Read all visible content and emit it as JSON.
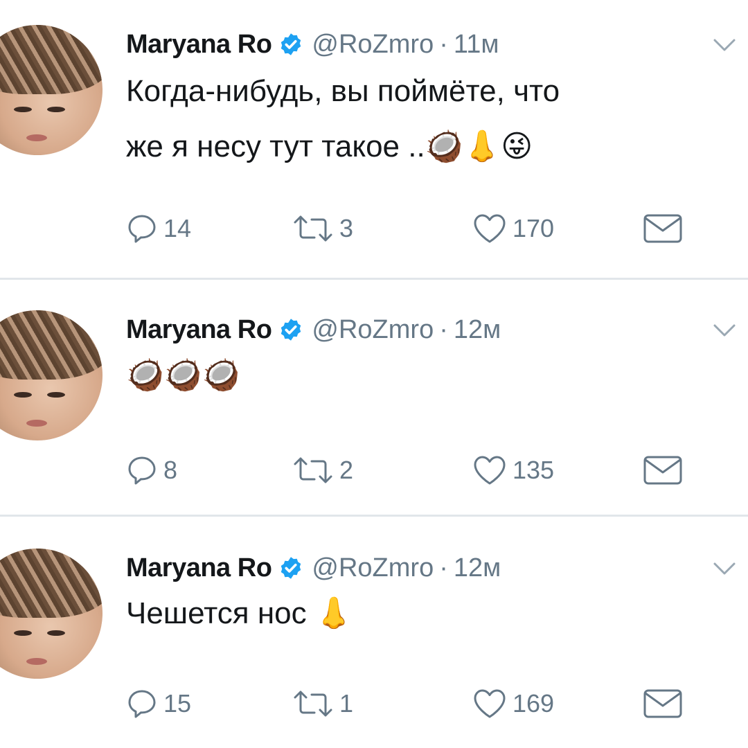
{
  "tweets": [
    {
      "name": "Maryana Ro",
      "handle": "@RoZmro",
      "separator": "·",
      "time": "11м",
      "text": "Когда-нибудь, вы поймёте, что\nже я несу тут такое ..🥥👃😜",
      "replies": "14",
      "retweets": "3",
      "likes": "170"
    },
    {
      "name": "Maryana Ro",
      "handle": "@RoZmro",
      "separator": "·",
      "time": "12м",
      "text": "🥥🥥🥥",
      "replies": "8",
      "retweets": "2",
      "likes": "135"
    },
    {
      "name": "Maryana Ro",
      "handle": "@RoZmro",
      "separator": "·",
      "time": "12м",
      "text": "Чешется нос 👃",
      "replies": "15",
      "retweets": "1",
      "likes": "169"
    }
  ],
  "icons": {
    "verified": "verified-badge-icon",
    "chevron": "chevron-down-icon",
    "reply": "reply-icon",
    "retweet": "retweet-icon",
    "like": "heart-icon",
    "dm": "envelope-icon"
  },
  "colors": {
    "verified": "#1da1f2",
    "secondary_text": "#657786",
    "primary_text": "#14171a",
    "divider": "#e1e6ea"
  }
}
